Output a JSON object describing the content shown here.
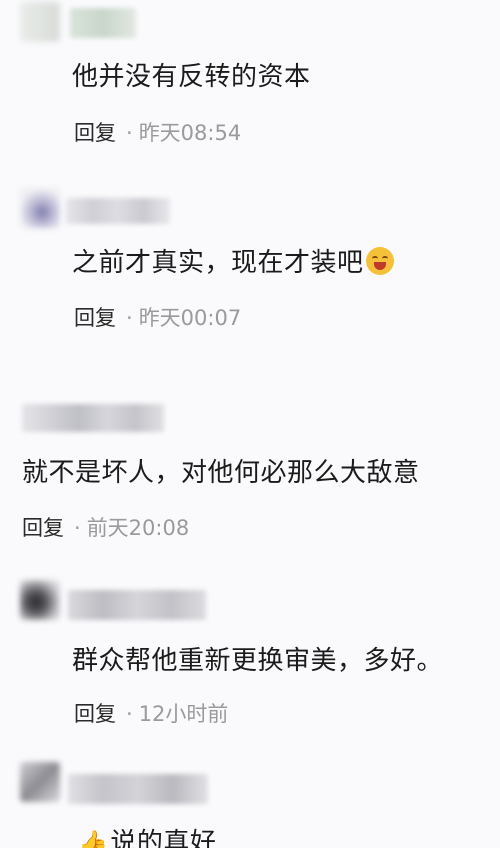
{
  "comments": [
    {
      "text": "他并没有反转的资本",
      "reply": "回复",
      "dot": "·",
      "time": "昨天08:54"
    },
    {
      "text": "之前才真实，现在才装吧",
      "emoji": "face-with-tears-of-joy",
      "reply": "回复",
      "dot": "·",
      "time": "昨天00:07"
    },
    {
      "text": "就不是坏人，对他何必那么大敌意",
      "reply": "回复",
      "dot": "·",
      "time": "前天20:08"
    },
    {
      "text": "群众帮他重新更换审美，多好。",
      "reply": "回复",
      "dot": "·",
      "time": "12小时前"
    },
    {
      "text": "说的真好",
      "icon": "thumbs-up-icon"
    }
  ]
}
